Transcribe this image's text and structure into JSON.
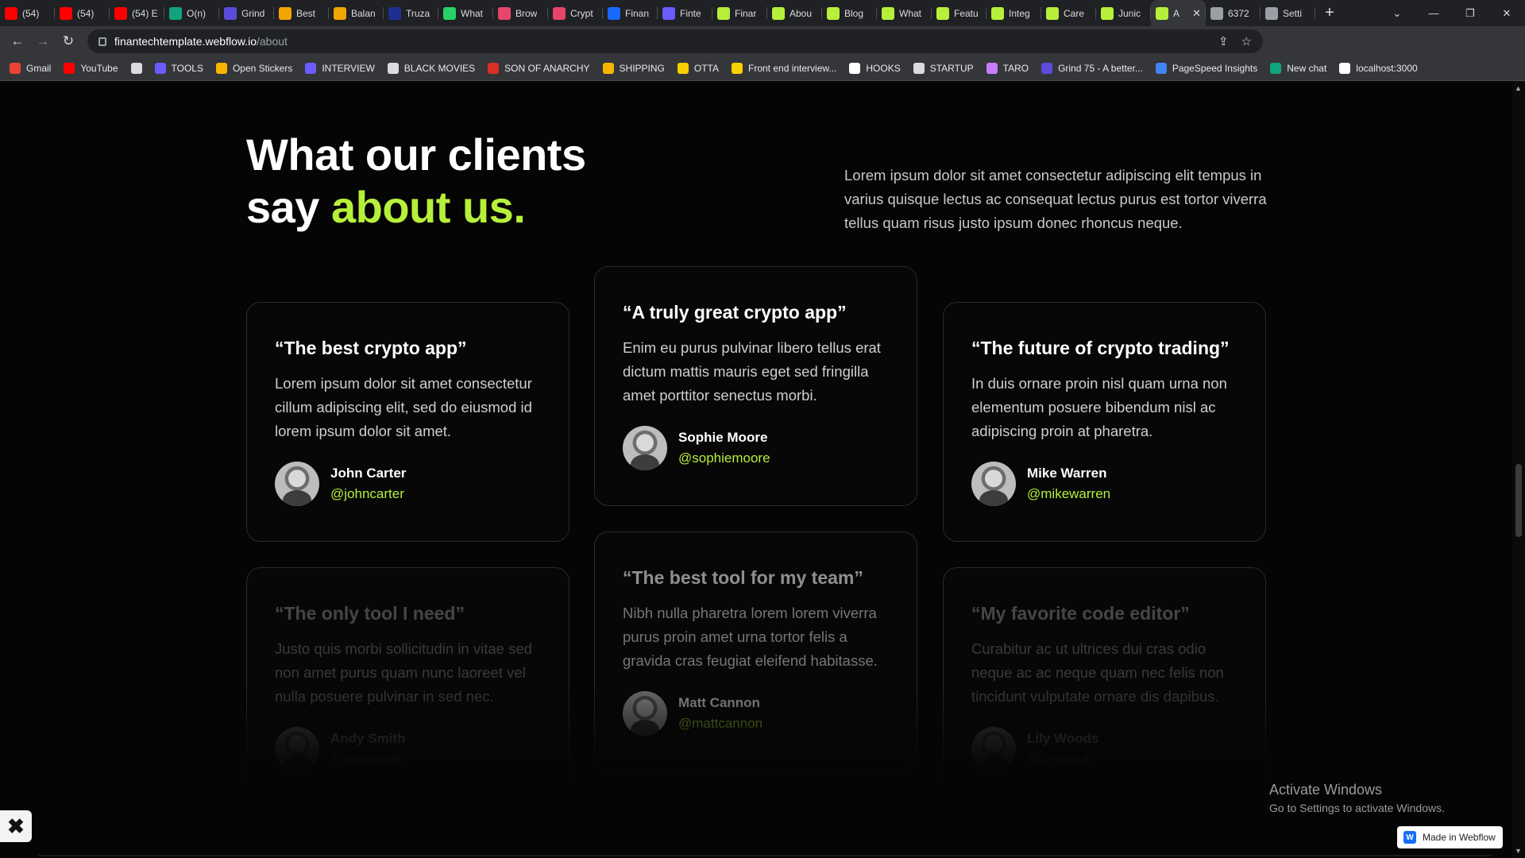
{
  "browser": {
    "tabs": [
      {
        "title": "(54)",
        "color": "#ff0000",
        "icon": "youtube-icon"
      },
      {
        "title": "(54)",
        "color": "#ff0000",
        "icon": "youtube-icon"
      },
      {
        "title": "(54) E",
        "color": "#ff0000",
        "icon": "youtube-icon"
      },
      {
        "title": "O(n)",
        "color": "#10a37f",
        "icon": "chatgpt-icon"
      },
      {
        "title": "Grind",
        "color": "#5b4bdb",
        "icon": "grind75-icon"
      },
      {
        "title": "Best",
        "color": "#f0a500",
        "icon": "leetcode-icon"
      },
      {
        "title": "Balan",
        "color": "#f0a500",
        "icon": "leetcode-icon"
      },
      {
        "title": "Truza",
        "color": "#1d2f8f",
        "icon": "truza-icon"
      },
      {
        "title": "What",
        "color": "#25d366",
        "icon": "whatsapp-icon"
      },
      {
        "title": "Brow",
        "color": "#e8446c",
        "icon": "dribbble-icon"
      },
      {
        "title": "Crypt",
        "color": "#e8446c",
        "icon": "dribbble-icon"
      },
      {
        "title": "Finan",
        "color": "#1769ff",
        "icon": "behance-icon"
      },
      {
        "title": "Finte",
        "color": "#6a5cff",
        "icon": "dots-icon"
      },
      {
        "title": "Finar",
        "color": "#b6f03a",
        "icon": "webflow-template-icon"
      },
      {
        "title": "Abou",
        "color": "#b6f03a",
        "icon": "webflow-template-icon"
      },
      {
        "title": "Blog",
        "color": "#b6f03a",
        "icon": "webflow-template-icon"
      },
      {
        "title": "What",
        "color": "#b6f03a",
        "icon": "webflow-template-icon"
      },
      {
        "title": "Featu",
        "color": "#b6f03a",
        "icon": "webflow-template-icon"
      },
      {
        "title": "Integ",
        "color": "#b6f03a",
        "icon": "webflow-template-icon"
      },
      {
        "title": "Care",
        "color": "#b6f03a",
        "icon": "webflow-template-icon"
      },
      {
        "title": "Junic",
        "color": "#b6f03a",
        "icon": "webflow-template-icon"
      },
      {
        "title": "A",
        "color": "#b6f03a",
        "icon": "webflow-template-icon",
        "active": true
      },
      {
        "title": "6372",
        "color": "#9aa0a6",
        "icon": "globe-icon"
      },
      {
        "title": "Setti",
        "color": "#9aa0a6",
        "icon": "gear-icon"
      }
    ],
    "new_tab": "+",
    "close_tab": "✕",
    "url_host": "finantechtemplate.webflow.io",
    "url_path": "/about",
    "bookmarks": [
      {
        "label": "Gmail",
        "color": "#ea4335",
        "icon": "gmail-icon"
      },
      {
        "label": "YouTube",
        "color": "#ff0000",
        "icon": "youtube-icon"
      },
      {
        "label": "",
        "color": "#dadce0",
        "icon": "globe-icon"
      },
      {
        "label": "TOOLS",
        "color": "#6a5cff",
        "icon": "folder-icon"
      },
      {
        "label": "Open Stickers",
        "color": "#f7b500",
        "icon": "sticker-icon"
      },
      {
        "label": "INTERVIEW",
        "color": "#6a5cff",
        "icon": "folder-icon"
      },
      {
        "label": "BLACK MOVIES",
        "color": "#dadce0",
        "icon": "globe-icon"
      },
      {
        "label": "SON OF ANARCHY",
        "color": "#d93025",
        "icon": "folder-icon"
      },
      {
        "label": "SHIPPING",
        "color": "#f7b500",
        "icon": "folder-icon"
      },
      {
        "label": "OTTA",
        "color": "#f7d000",
        "icon": "otta-icon"
      },
      {
        "label": "Front end interview...",
        "color": "#f7d000",
        "icon": "bookmark-icon"
      },
      {
        "label": "HOOKS",
        "color": "#ffffff",
        "icon": "hooks-icon"
      },
      {
        "label": "STARTUP",
        "color": "#dadce0",
        "icon": "folder-icon"
      },
      {
        "label": "TARO",
        "color": "#c77dff",
        "icon": "taro-icon"
      },
      {
        "label": "Grind 75 - A better...",
        "color": "#5b4bdb",
        "icon": "grind75-icon"
      },
      {
        "label": "PageSpeed Insights",
        "color": "#4285f4",
        "icon": "pagespeed-icon"
      },
      {
        "label": "New chat",
        "color": "#10a37f",
        "icon": "chatgpt-icon"
      },
      {
        "label": "localhost:3000",
        "color": "#ffffff",
        "icon": "triangle-icon"
      }
    ]
  },
  "section": {
    "heading_line1": "What our clients",
    "heading_line2_plain": "say ",
    "heading_line2_accent": "about us.",
    "intro": "Lorem ipsum dolor sit amet consectetur adipiscing elit tempus in varius quisque lectus ac consequat lectus purus est tortor viverra tellus quam risus justo ipsum donec rhoncus neque.",
    "accent_color": "#b6f03a"
  },
  "testimonials": [
    {
      "quote": "“The best crypto app”",
      "body": "Lorem ipsum dolor sit amet consectetur cillum adipiscing elit, sed do eiusmod  id lorem ipsum dolor sit amet.",
      "name": "John Carter",
      "handle": "@johncarter"
    },
    {
      "quote": "“A truly great crypto app”",
      "body": "Enim eu purus pulvinar libero tellus erat dictum mattis mauris eget sed fringilla amet porttitor senectus morbi.",
      "name": "Sophie Moore",
      "handle": "@sophiemoore"
    },
    {
      "quote": "“The future of crypto trading”",
      "body": "In duis ornare proin nisl quam urna non elementum posuere bibendum nisl ac adipiscing proin at pharetra.",
      "name": "Mike Warren",
      "handle": "@mikewarren"
    },
    {
      "quote": "“The only tool I need”",
      "body": "Justo quis morbi sollicitudin in vitae sed non amet purus quam nunc laoreet vel nulla posuere pulvinar in sed nec.",
      "name": "Andy Smith",
      "handle": "@andysmith"
    },
    {
      "quote": "“The best tool for my team”",
      "body": "Nibh nulla pharetra lorem lorem viverra purus proin amet urna tortor felis a gravida cras feugiat eleifend habitasse.",
      "name": "Matt Cannon",
      "handle": "@mattcannon"
    },
    {
      "quote": "“My favorite code editor”",
      "body": "Curabitur ac ut ultrices dui cras odio neque ac ac neque quam nec felis non tincidunt vulputate ornare dis dapibus.",
      "name": "Lily Woods",
      "handle": "@lilywoods"
    }
  ],
  "overlay": {
    "windows_title": "Activate Windows",
    "windows_sub": "Go to Settings to activate Windows.",
    "webflow_badge": "Made in Webflow",
    "webflow_logo": "W",
    "corner_close": "✖"
  }
}
